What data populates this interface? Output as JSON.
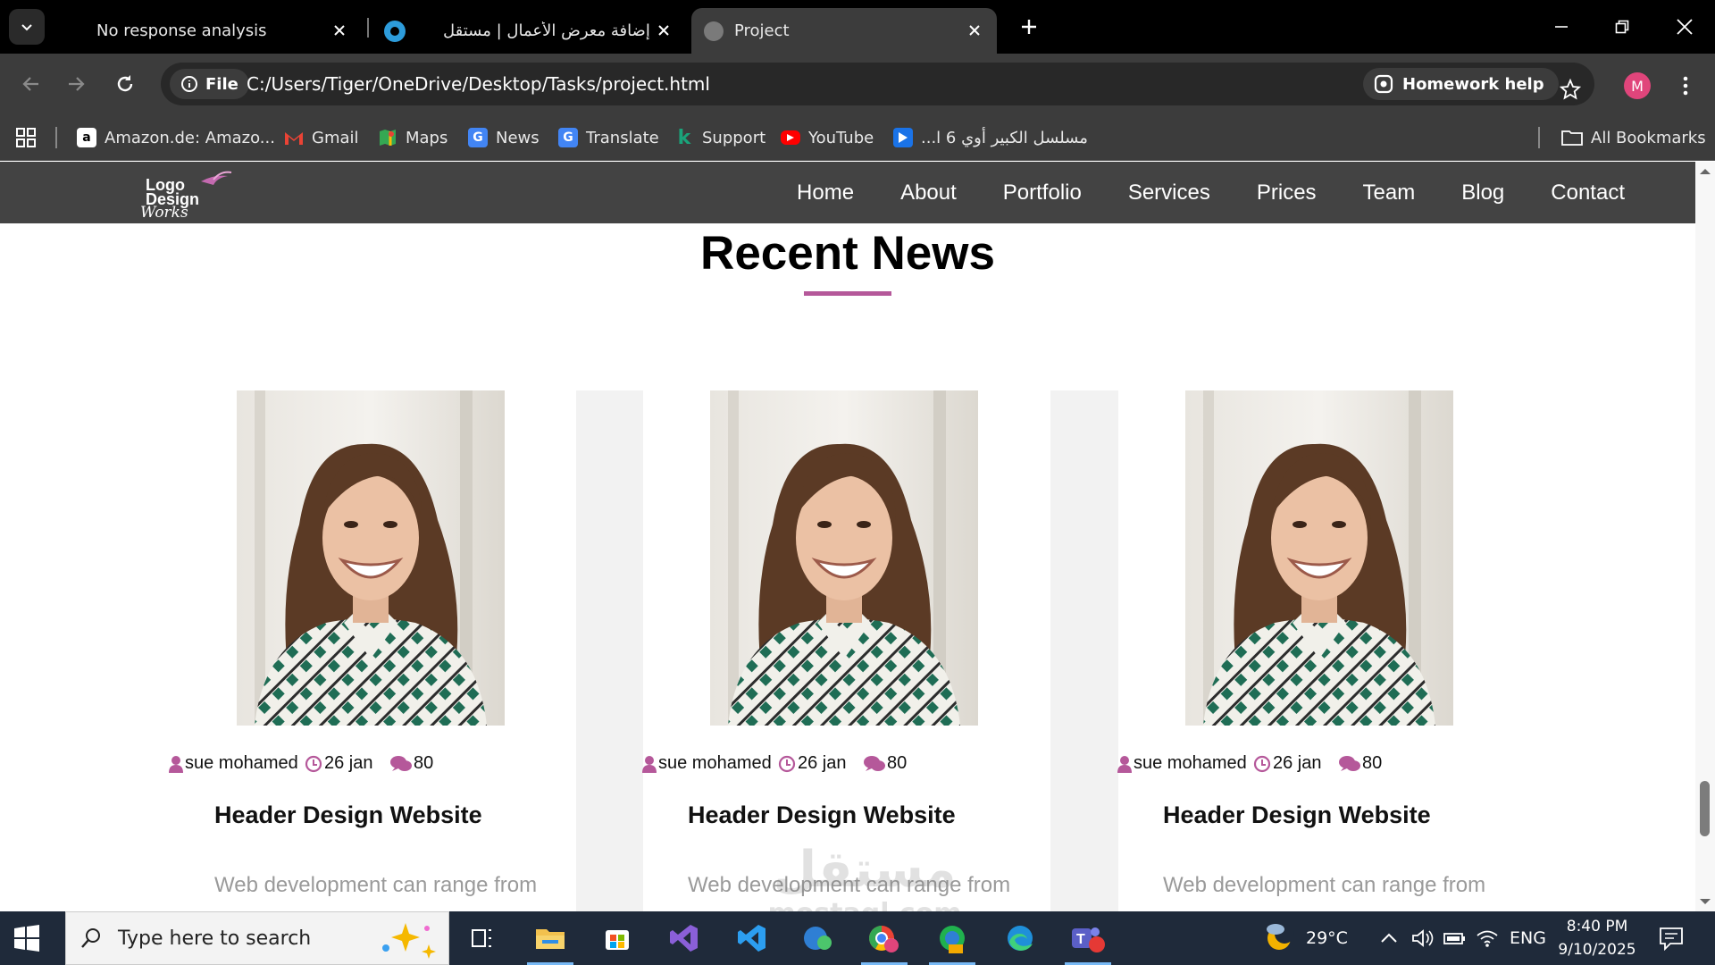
{
  "browser": {
    "tabs": [
      {
        "title": "No response analysis",
        "active": false
      },
      {
        "title": "إضافة معرض الأعمال | مستقل",
        "active": false
      },
      {
        "title": "Project",
        "active": true
      }
    ],
    "site_chip": "File",
    "url": "C:/Users/Tiger/OneDrive/Desktop/Tasks/project.html",
    "homework_help": "Homework help",
    "profile_initial": "M",
    "bookmarks": [
      {
        "label": "Amazon.de: Amazo...",
        "icon": "amazon-icon"
      },
      {
        "label": "Gmail",
        "icon": "gmail-icon"
      },
      {
        "label": "Maps",
        "icon": "maps-icon"
      },
      {
        "label": "News",
        "icon": "news-icon"
      },
      {
        "label": "Translate",
        "icon": "translate-icon"
      },
      {
        "label": "Support",
        "icon": "support-icon"
      },
      {
        "label": "YouTube",
        "icon": "youtube-icon"
      },
      {
        "label": "مسلسل الكبير أوي 6 ا...",
        "icon": "play-icon"
      }
    ],
    "all_bookmarks": "All Bookmarks"
  },
  "site": {
    "logo_lines": [
      "Logo",
      "Design",
      "Works"
    ],
    "nav": [
      "Home",
      "About",
      "Portfolio",
      "Services",
      "Prices",
      "Team",
      "Blog",
      "Contact"
    ],
    "section_title": "Recent News",
    "accent_color": "#b5589a",
    "cards": [
      {
        "author": "sue mohamed",
        "date": "26 jan",
        "comments": "80",
        "heading": "Header Design Website",
        "text": "Web development can range from"
      },
      {
        "author": "sue mohamed",
        "date": "26 jan",
        "comments": "80",
        "heading": "Header Design Website",
        "text": "Web development can range from"
      },
      {
        "author": "sue mohamed",
        "date": "26 jan",
        "comments": "80",
        "heading": "Header Design Website",
        "text": "Web development can range from"
      }
    ],
    "watermark": "مستقل",
    "watermark_sub": "mostaql.com"
  },
  "taskbar": {
    "search_placeholder": "Type here to search",
    "weather": "29°C",
    "language": "ENG",
    "time": "8:40 PM",
    "date": "9/10/2025"
  }
}
